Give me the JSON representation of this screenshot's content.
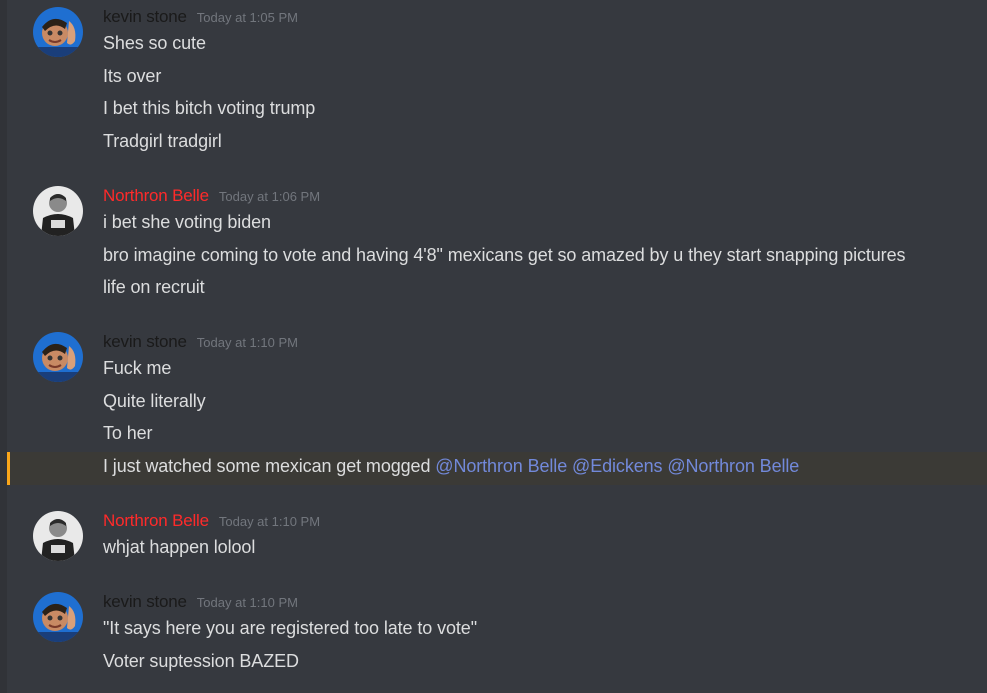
{
  "colors": {
    "background": "#36393f",
    "kevin_name": "#1a1a1a",
    "northron_name": "#ff2a2a",
    "message_text": "#dcddde",
    "timestamp": "#72767d",
    "mention": "#7289da",
    "mention_highlight_bar": "#faa61a"
  },
  "messages": [
    {
      "author": "kevin stone",
      "timestamp": "Today at 1:05 PM",
      "lines": [
        "Shes so cute",
        "Its over",
        "I bet this bitch voting trump",
        "Tradgirl tradgirl"
      ]
    },
    {
      "author": "Northron Belle",
      "timestamp": "Today at 1:06 PM",
      "lines": [
        "i bet she voting biden",
        "bro imagine coming to vote and having 4'8\" mexicans get so amazed by u they start snapping pictures",
        "life on recruit"
      ]
    },
    {
      "author": "kevin stone",
      "timestamp": "Today at 1:10 PM",
      "lines": [
        "Fuck me",
        "Quite literally",
        "To her"
      ],
      "mention_line": {
        "text": "I just watched some mexican get mogged ",
        "mentions": [
          "@Northron Belle",
          "@Edickens",
          "@Northron Belle"
        ]
      }
    },
    {
      "author": "Northron Belle",
      "timestamp": "Today at 1:10 PM",
      "lines": [
        "whjat happen lolool"
      ]
    },
    {
      "author": "kevin stone",
      "timestamp": "Today at 1:10 PM",
      "lines": [
        "\"It says here you are registered too late to vote\"",
        "Voter suptession BAZED"
      ]
    }
  ]
}
